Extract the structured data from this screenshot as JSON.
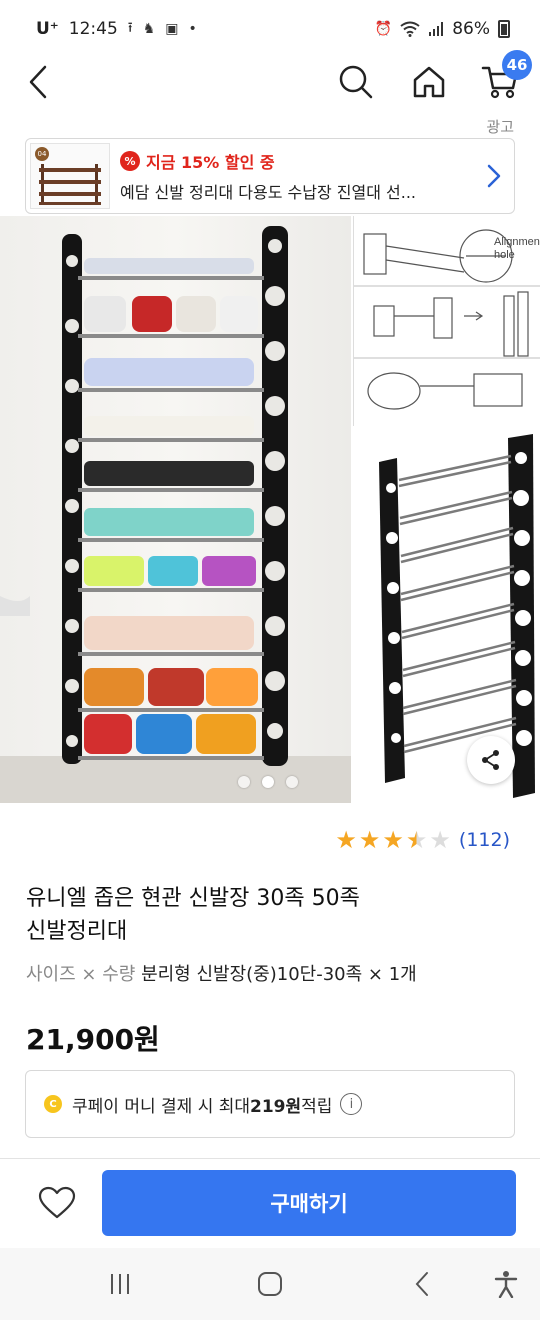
{
  "status_bar": {
    "carrier": "U⁺",
    "time": "12:45",
    "battery": "86%"
  },
  "header": {
    "cart_count": "46"
  },
  "ad": {
    "label": "광고",
    "promo": "지금 15% 할인 중",
    "title": "예담 신발 정리대 다용도 수납장 진열대 선...",
    "thumb_badge": "04"
  },
  "gallery": {
    "diagram_label": "Alignment hole",
    "page_count": 3,
    "current_page": 2
  },
  "rating": {
    "score": 3.5,
    "max": 5,
    "review_count": "(112)"
  },
  "product": {
    "title_line1": "유니엘 좁은 현관 신발장 30족 50족",
    "title_line2": "신발정리대",
    "option_key": "사이즈 × 수량",
    "option_value": "분리형 신발장(중)10단-30족 × 1개",
    "price": "21,900원"
  },
  "coupay": {
    "prefix": "쿠페이 머니 결제 시 최대 ",
    "amount": "219원",
    "suffix": " 적립"
  },
  "actions": {
    "buy_label": "구매하기"
  },
  "colors": {
    "accent": "#3576f0",
    "promo_red": "#e0251c",
    "star": "#f5a623",
    "link_blue": "#2856c7"
  }
}
